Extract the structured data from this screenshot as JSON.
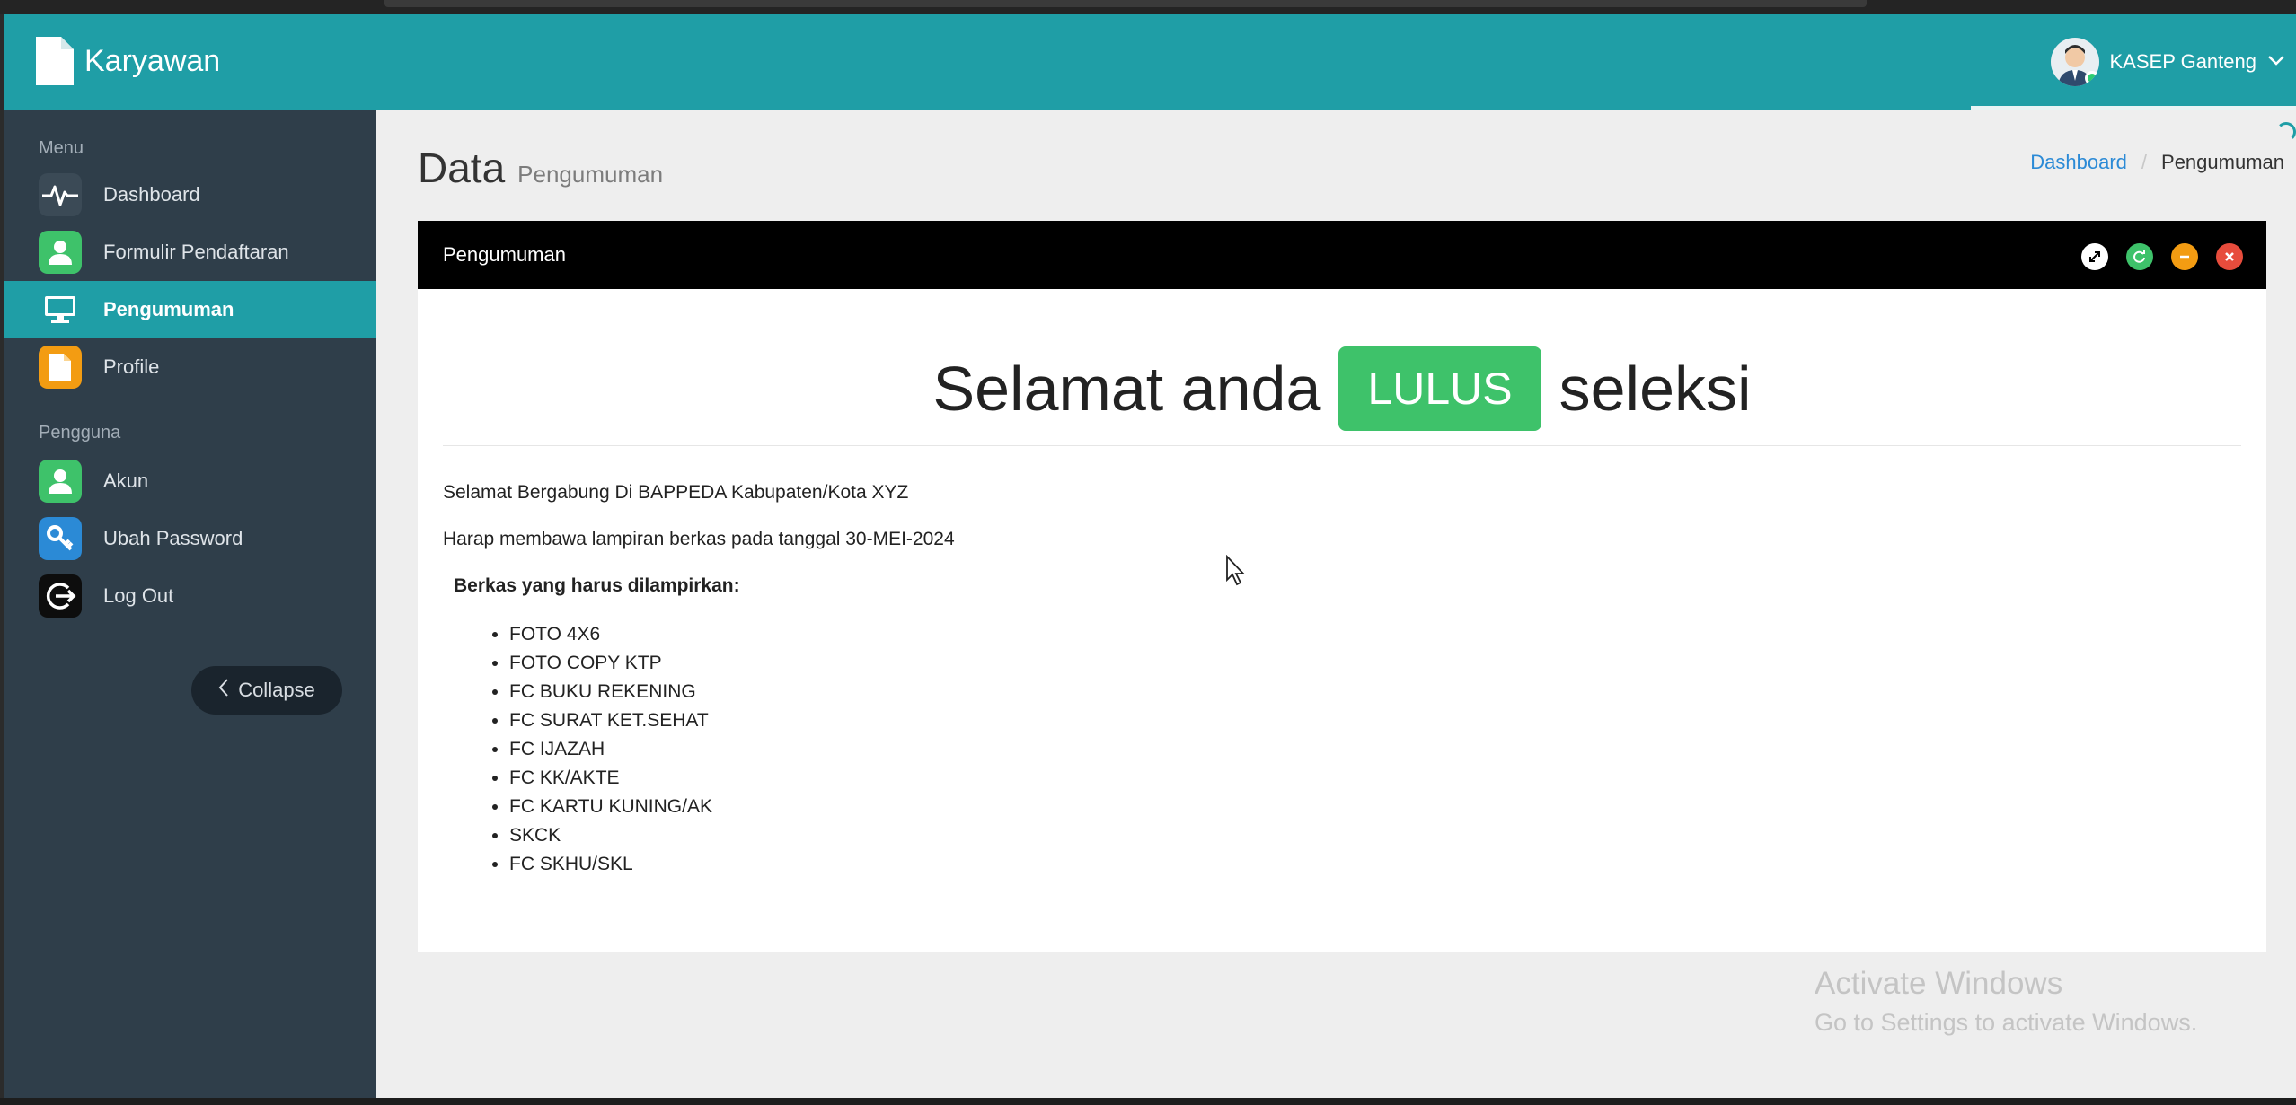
{
  "brand": {
    "name": "Karyawan"
  },
  "user": {
    "name": "KASEP Ganteng"
  },
  "sidebar": {
    "section_menu": "Menu",
    "menu_items": [
      {
        "label": "Dashboard",
        "icon": "heartbeat-icon"
      },
      {
        "label": "Formulir Pendaftaran",
        "icon": "user-icon"
      },
      {
        "label": "Pengumuman",
        "icon": "monitor-icon",
        "active": true
      },
      {
        "label": "Profile",
        "icon": "file-icon"
      }
    ],
    "section_user": "Pengguna",
    "user_items": [
      {
        "label": "Akun",
        "icon": "user-icon"
      },
      {
        "label": "Ubah Password",
        "icon": "key-icon"
      },
      {
        "label": "Log Out",
        "icon": "logout-icon"
      }
    ],
    "collapse_label": "Collapse"
  },
  "page": {
    "title": "Data",
    "subtitle": "Pengumuman",
    "breadcrumb": {
      "home": "Dashboard",
      "separator": "/",
      "current": "Pengumuman"
    }
  },
  "panel": {
    "title": "Pengumuman",
    "hero": {
      "before": "Selamat anda",
      "badge": "LULUS",
      "after": "seleksi"
    },
    "line1": "Selamat Bergabung Di BAPPEDA Kabupaten/Kota XYZ",
    "line2": "Harap membawa lampiran berkas pada tanggal 30-MEI-2024",
    "requirements_title": "Berkas yang harus dilampirkan:",
    "requirements": [
      "FOTO 4X6",
      "FOTO COPY KTP",
      "FC BUKU REKENING",
      "FC SURAT KET.SEHAT",
      "FC IJAZAH",
      "FC KK/AKTE",
      "FC KARTU KUNING/AK",
      "SKCK",
      "FC SKHU/SKL"
    ]
  },
  "watermark": {
    "line1": "Activate Windows",
    "line2": "Go to Settings to activate Windows."
  },
  "colors": {
    "header": "#1f9ea6",
    "sidebar": "#2f3e4a",
    "badge": "#3ec26a",
    "panel_head": "#000000"
  }
}
